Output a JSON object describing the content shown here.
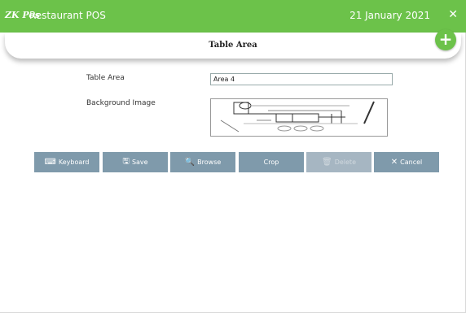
{
  "titlebar": {
    "logo": "ZK Pos",
    "app_title": "Restaurant POS",
    "date": "21 January 2021",
    "close_icon": "close-icon"
  },
  "header": {
    "title": "Table Area"
  },
  "form": {
    "table_area_label": "Table Area",
    "table_area_value": "Area 4",
    "background_label": "Background Image"
  },
  "toolbar": {
    "keyboard": "Keyboard",
    "save": "Save",
    "browse": "Browse",
    "crop": "Crop",
    "delete": "Delete",
    "cancel": "Cancel"
  },
  "colors": {
    "accent": "#6cc24a",
    "button": "#7f9aab",
    "button_disabled": "#a6b6c2"
  }
}
